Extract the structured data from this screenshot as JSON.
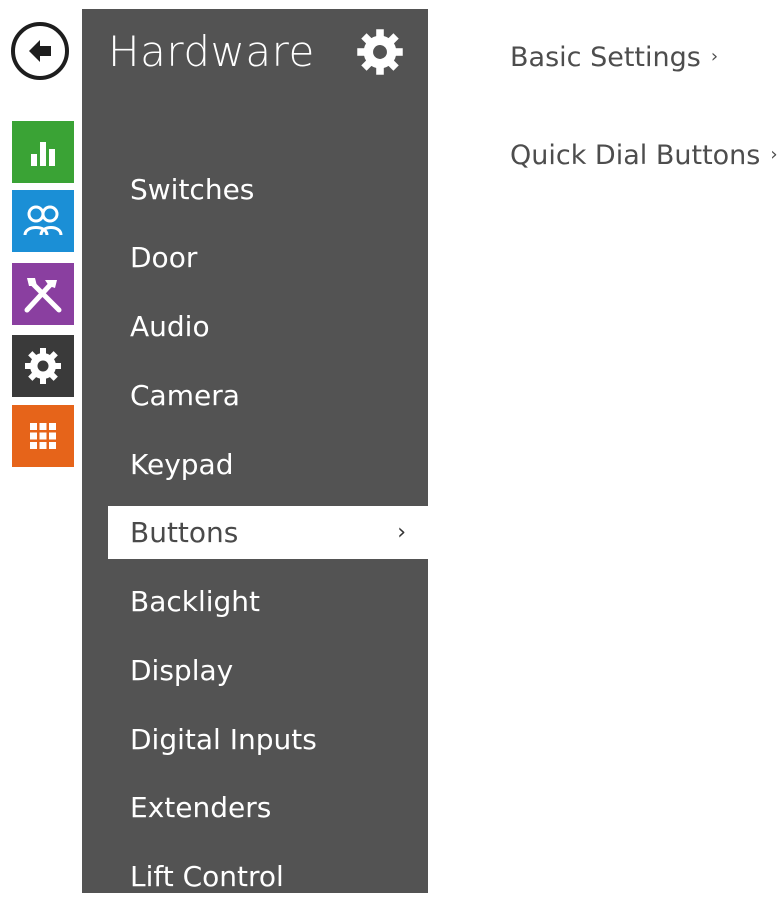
{
  "sidebar": {
    "title": "Hardware",
    "items": [
      {
        "label": "Switches"
      },
      {
        "label": "Door"
      },
      {
        "label": "Audio"
      },
      {
        "label": "Camera"
      },
      {
        "label": "Keypad"
      },
      {
        "label": "Buttons",
        "active": true,
        "chevron": "›"
      },
      {
        "label": "Backlight"
      },
      {
        "label": "Display"
      },
      {
        "label": "Digital Inputs"
      },
      {
        "label": "Extenders"
      },
      {
        "label": "Lift Control"
      }
    ]
  },
  "rail": {
    "icons": [
      {
        "name": "back-arrow-icon"
      },
      {
        "name": "status-chart-icon",
        "color": "#3aa335"
      },
      {
        "name": "users-icon",
        "color": "#1b8fd6"
      },
      {
        "name": "tools-icon",
        "color": "#8a3fa0"
      },
      {
        "name": "gear-icon",
        "color": "#3a3a3a"
      },
      {
        "name": "grid-icon",
        "color": "#e6641a"
      }
    ]
  },
  "content": {
    "links": [
      {
        "label": "Basic Settings",
        "chevron": "›"
      },
      {
        "label": "Quick Dial Buttons",
        "chevron": "›"
      }
    ]
  }
}
